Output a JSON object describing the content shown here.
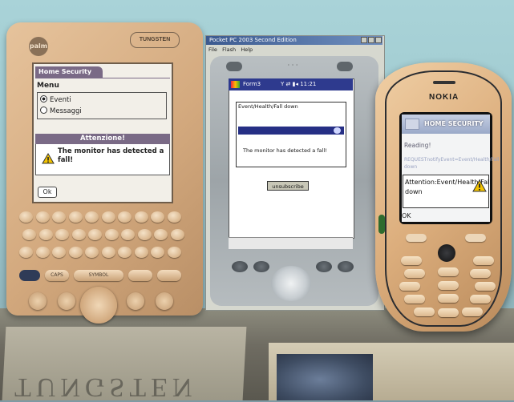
{
  "palm": {
    "logo": "palm",
    "brand": "TUNGSTEN",
    "app_title": "Home Security",
    "menu_label": "Menu",
    "options": [
      {
        "label": "Eventi",
        "selected": true
      },
      {
        "label": "Messaggi",
        "selected": false
      }
    ],
    "alert_title": "Attenzione!",
    "alert_message": "The monitor has detected a fall!",
    "ok_button": "Ok",
    "keys": {
      "caps": "CAPS",
      "symbol": "SYMBOL"
    }
  },
  "emulator": {
    "window_title": "Pocket PC 2003 Second Edition",
    "menu": [
      "File",
      "Flash",
      "Help"
    ],
    "form_title": "Form3",
    "clock": "11:21",
    "event_text": "Event/Health/Fall down",
    "message": "The monitor has detected a fall!",
    "unsubscribe_button": "unsubscribe"
  },
  "nokia": {
    "brand": "NOKIA",
    "app_title": "HOME SECURITY",
    "status": "Reading!",
    "request_text": "REQUESTnotifyEvent=Event/Health/Fall down",
    "alert_message": "Attention:Event/Health/Fall down",
    "ok_softkey": "OK"
  },
  "colors": {
    "palm_accent": "#7a6a86",
    "ppc_titlebar": "#2e3a8e",
    "nokia_titlebar": "#9aa9c8",
    "warning": "#f2c200"
  },
  "icons": [
    "warning-icon",
    "radio-icon",
    "navigation-icon"
  ]
}
